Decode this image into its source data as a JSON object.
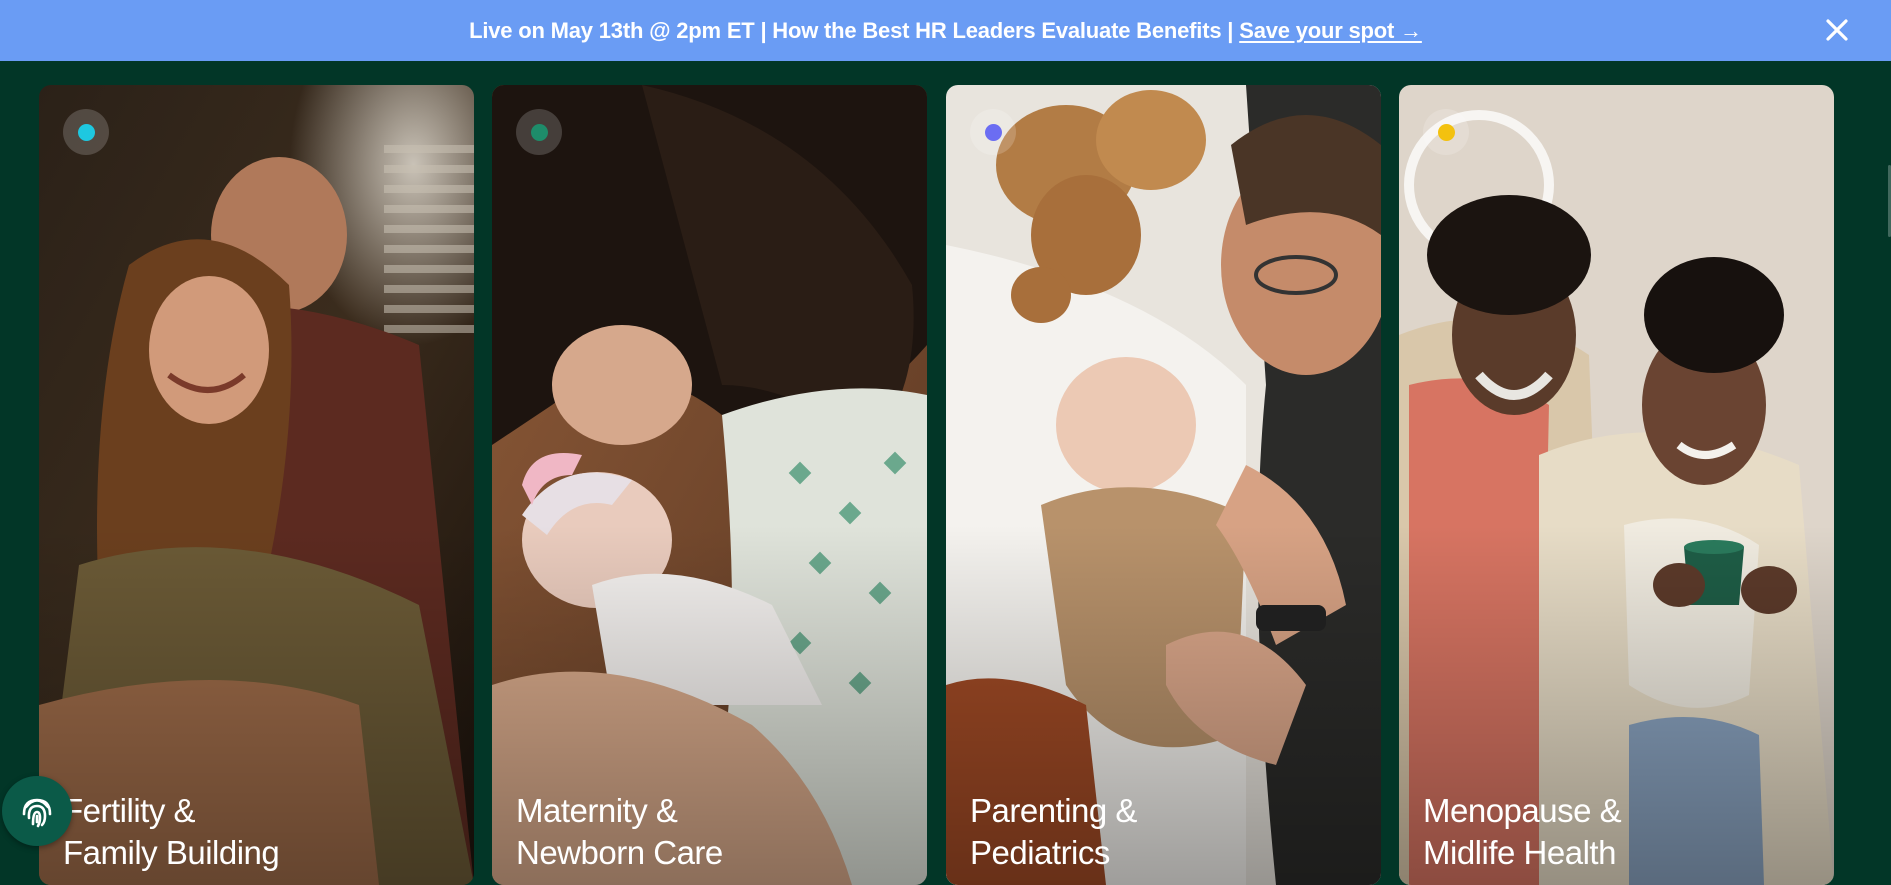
{
  "banner": {
    "text": "Live on May 13th @ 2pm ET | How the Best HR Leaders Evaluate Benefits |",
    "link_label": "Save your spot →",
    "close_icon": "close-icon",
    "background": "#6a9cf4"
  },
  "cards": [
    {
      "title_line1": "Fertility &",
      "title_line2": "Family Building",
      "dot_color": "#1ec8e0"
    },
    {
      "title_line1": "Maternity &",
      "title_line2": "Newborn Care",
      "dot_color": "#1e8c6a"
    },
    {
      "title_line1": "Parenting &",
      "title_line2": "Pediatrics",
      "dot_color": "#6b6df2"
    },
    {
      "title_line1": "Menopause &",
      "title_line2": "Midlife Health",
      "dot_color": "#f3c10f"
    }
  ],
  "chat_button": {
    "icon": "fingerprint-icon"
  },
  "colors": {
    "page_background": "#023627",
    "banner": "#6a9cf4"
  }
}
